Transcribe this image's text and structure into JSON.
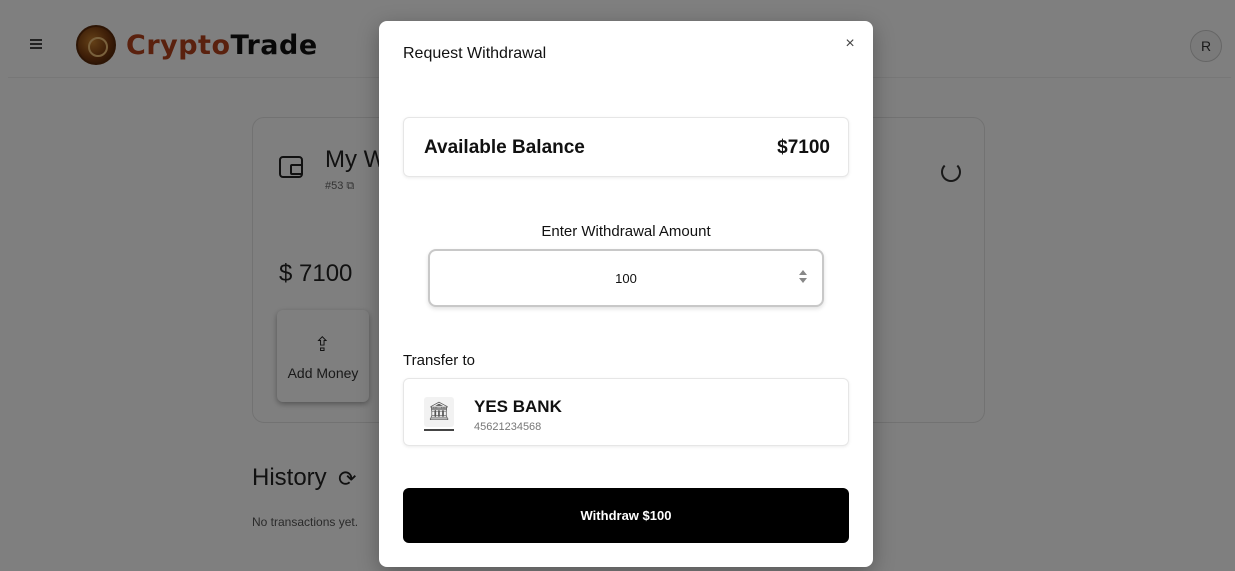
{
  "app": {
    "brand_part1": "Crypto",
    "brand_part2": "Trade",
    "avatar_initial": "R"
  },
  "wallet": {
    "title": "My W",
    "id": "#53",
    "balance_display": "$ 7100",
    "add_money_label": "Add Money"
  },
  "history": {
    "title": "History",
    "empty_text": "No transactions yet."
  },
  "modal": {
    "title": "Request Withdrawal",
    "close_symbol": "×",
    "balance_label": "Available Balance",
    "balance_value": "$7100",
    "amount_label": "Enter Withdrawal Amount",
    "amount_value": "100",
    "transfer_label": "Transfer to",
    "bank": {
      "name": "YES BANK",
      "account": "45621234568"
    },
    "withdraw_button_label": "Withdraw $100"
  },
  "colors": {
    "brand_accent": "#b5431c",
    "primary_button": "#000000",
    "overlay": "rgba(0,0,0,0.5)"
  },
  "icons": {
    "menu": "hamburger-icon",
    "close": "close-icon",
    "wallet": "wallet-icon",
    "refresh": "refresh-icon",
    "upload": "upload-icon",
    "history": "history-icon",
    "bank": "bank-icon"
  }
}
